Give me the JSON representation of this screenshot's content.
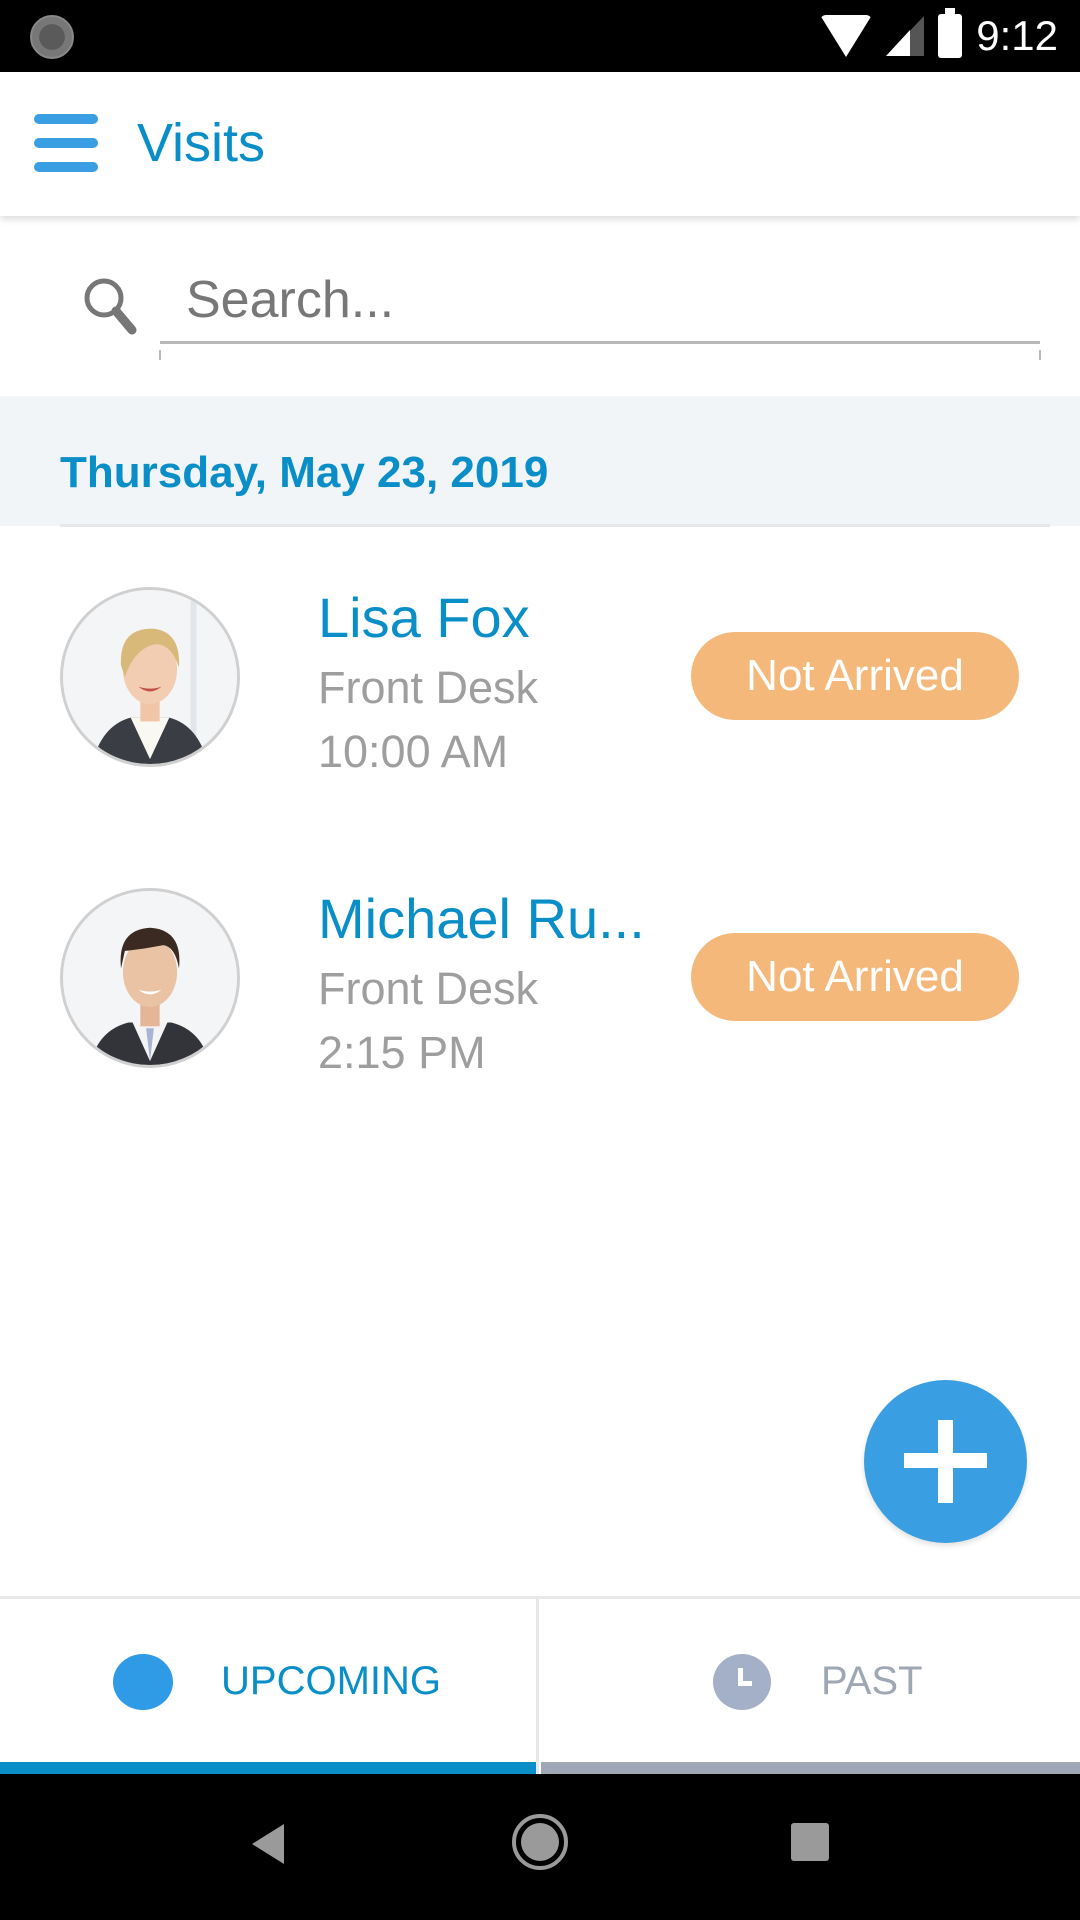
{
  "status_bar": {
    "time": "9:12",
    "icons": [
      "loading-spinner-icon",
      "wifi-icon",
      "cell-signal-icon",
      "battery-icon"
    ]
  },
  "app_bar": {
    "menu_icon": "hamburger-menu-icon",
    "title": "Visits"
  },
  "search": {
    "icon": "search-icon",
    "placeholder": "Search...",
    "value": ""
  },
  "date_header": {
    "label": "Thursday, May 23, 2019"
  },
  "visits": [
    {
      "name": "Lisa Fox",
      "location": "Front Desk",
      "time": "10:00 AM",
      "status": "Not Arrived",
      "avatar": "photo-woman-blonde"
    },
    {
      "name": "Michael Ru...",
      "location": "Front Desk",
      "time": "2:15 PM",
      "status": "Not Arrived",
      "avatar": "photo-man-dark-hair"
    }
  ],
  "fab": {
    "icon": "plus-icon",
    "action": "add-visit"
  },
  "tabs": [
    {
      "label": "UPCOMING",
      "icon": "dot-icon",
      "active": true
    },
    {
      "label": "PAST",
      "icon": "clock-icon",
      "active": false
    }
  ],
  "nav_bar": {
    "buttons": [
      "back-icon",
      "home-icon",
      "recents-icon"
    ]
  },
  "colors": {
    "accent": "#0a8ec8",
    "menu_blue": "#3a9ee2",
    "status_not_arrived": "#f4b87a",
    "inactive_tab": "#9ea7b3",
    "secondary_text": "#9e9e9e",
    "date_header_bg": "#f2f5f8"
  }
}
